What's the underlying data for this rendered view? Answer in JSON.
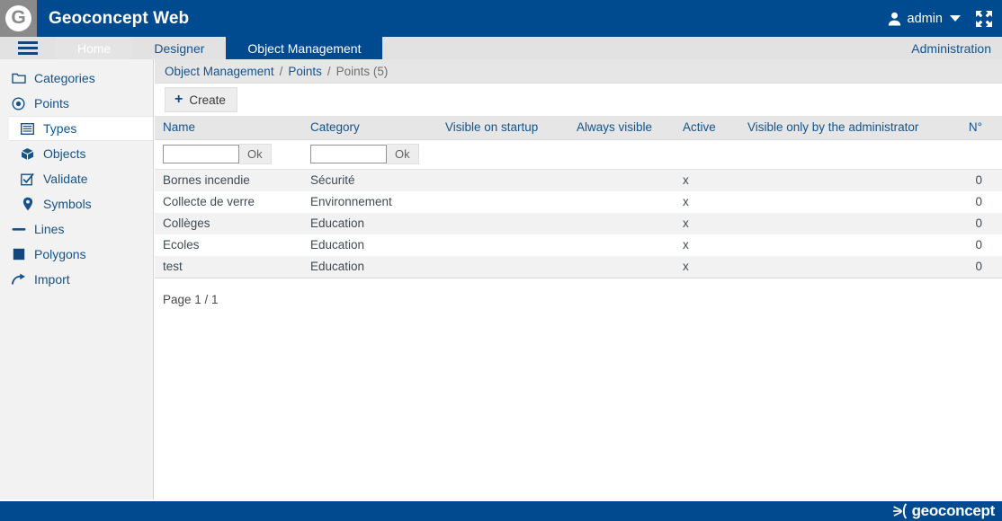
{
  "header": {
    "logo_letter": "G",
    "title": "Geoconcept Web",
    "user_name": "admin",
    "user_icon": "user-icon",
    "caret_icon": "chevron-down-icon",
    "fullscreen_icon": "fullscreen-expand-icon"
  },
  "nav": {
    "menu_icon": "hamburger-menu-icon",
    "tabs": [
      {
        "label": "Home",
        "state": "ghost"
      },
      {
        "label": "Designer",
        "state": "normal"
      },
      {
        "label": "Object Management",
        "state": "active"
      }
    ],
    "right_link": "Administration"
  },
  "sidebar": {
    "items": [
      {
        "label": "Categories",
        "icon": "folder-icon",
        "level": "top",
        "selected": false
      },
      {
        "label": "Points",
        "icon": "target-point-icon",
        "level": "top",
        "selected": false
      },
      {
        "label": "Types",
        "icon": "list-types-icon",
        "level": "sub",
        "selected": true
      },
      {
        "label": "Objects",
        "icon": "cube-objects-icon",
        "level": "sub",
        "selected": false
      },
      {
        "label": "Validate",
        "icon": "checkbox-check-icon",
        "level": "sub",
        "selected": false
      },
      {
        "label": "Symbols",
        "icon": "map-pin-icon",
        "level": "sub",
        "selected": false
      },
      {
        "label": "Lines",
        "icon": "line-icon",
        "level": "top",
        "selected": false
      },
      {
        "label": "Polygons",
        "icon": "filled-square-icon",
        "level": "top",
        "selected": false
      },
      {
        "label": "Import",
        "icon": "arrow-import-icon",
        "level": "top",
        "selected": false
      }
    ]
  },
  "breadcrumb": {
    "root": "Object Management",
    "sep": "/",
    "parent": "Points",
    "current": "Points (5)"
  },
  "toolbar": {
    "create_label": "Create",
    "create_icon": "plus-icon"
  },
  "table": {
    "columns": [
      "Name",
      "Category",
      "Visible on startup",
      "Always visible",
      "Active",
      "Visible only by the administrator",
      "N°"
    ],
    "filters": {
      "name_value": "",
      "name_placeholder": "",
      "name_ok": "Ok",
      "category_value": "",
      "category_placeholder": "",
      "category_ok": "Ok"
    },
    "rows": [
      {
        "name": "Bornes incendie",
        "category": "Sécurité",
        "visible_startup": "",
        "always_visible": "",
        "active": "x",
        "admin_only": "",
        "num": "0"
      },
      {
        "name": "Collecte de verre",
        "category": "Environnement",
        "visible_startup": "",
        "always_visible": "",
        "active": "x",
        "admin_only": "",
        "num": "0"
      },
      {
        "name": "Collèges",
        "category": "Education",
        "visible_startup": "",
        "always_visible": "",
        "active": "x",
        "admin_only": "",
        "num": "0"
      },
      {
        "name": "Ecoles",
        "category": "Education",
        "visible_startup": "",
        "always_visible": "",
        "active": "x",
        "admin_only": "",
        "num": "0"
      },
      {
        "name": "test",
        "category": "Education",
        "visible_startup": "",
        "always_visible": "",
        "active": "x",
        "admin_only": "",
        "num": "0"
      }
    ],
    "pager": "Page 1 / 1"
  },
  "footer": {
    "brand": "geoconcept",
    "brand_icon": "rays-burst-icon"
  },
  "colors": {
    "brand_blue": "#014a8f",
    "link_blue": "#15538c",
    "nav_gray": "#e2e2e2",
    "panel_gray": "#f2f2f2"
  }
}
